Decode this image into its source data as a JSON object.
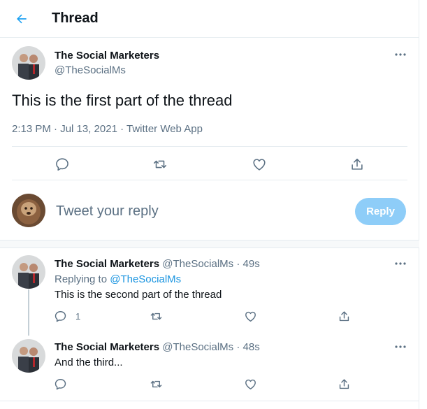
{
  "header": {
    "title": "Thread"
  },
  "main_tweet": {
    "name": "The Social Marketers",
    "handle": "@TheSocialMs",
    "text": "This is the first part of the thread",
    "meta": "2:13 PM · Jul 13, 2021 · Twitter Web App"
  },
  "reply_box": {
    "placeholder": "Tweet your reply",
    "button_label": "Reply"
  },
  "replies": [
    {
      "name": "The Social Marketers",
      "handle_time": "@TheSocialMs · 49s",
      "replying_prefix": "Replying to",
      "replying_handle": "@TheSocialMs",
      "text": "This is the second part of the thread",
      "reply_count": "1"
    },
    {
      "name": "The Social Marketers",
      "handle_time": "@TheSocialMs · 48s",
      "text": "And the third..."
    }
  ],
  "colors": {
    "accent": "#1da1f2",
    "muted": "#5b7083",
    "reply_button": "#8ecdf8"
  }
}
